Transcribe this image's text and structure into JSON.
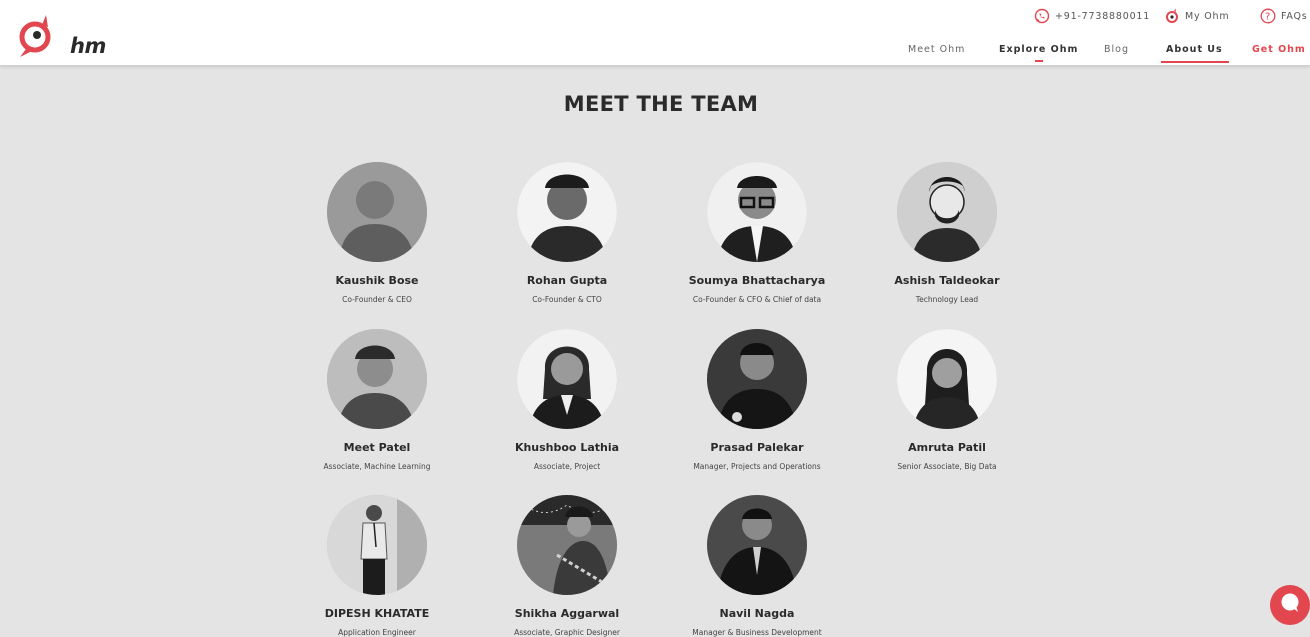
{
  "brand": {
    "logo_text": "hm",
    "accent": "#e2474f"
  },
  "top_links": [
    {
      "icon": "whatsapp-icon",
      "label": "+91-7738880011"
    },
    {
      "icon": "ohm-pin-icon",
      "label": "My Ohm"
    },
    {
      "icon": "question-icon",
      "label": "FAQs"
    }
  ],
  "nav": [
    {
      "label": "Meet Ohm"
    },
    {
      "label": "Explore Ohm"
    },
    {
      "label": "Blog"
    },
    {
      "label": "About Us",
      "active": true
    },
    {
      "label": "Get Ohm"
    }
  ],
  "section": {
    "title": "MEET THE TEAM"
  },
  "team": [
    {
      "name": "Kaushik Bose",
      "role": "Co-Founder & CEO"
    },
    {
      "name": "Rohan Gupta",
      "role": "Co-Founder & CTO"
    },
    {
      "name": "Soumya Bhattacharya",
      "role": "Co-Founder & CFO & Chief of data"
    },
    {
      "name": "Ashish Taldeokar",
      "role": "Technology Lead"
    },
    {
      "name": "Meet Patel",
      "role": "Associate, Machine Learning"
    },
    {
      "name": "Khushboo Lathia",
      "role": "Associate, Project"
    },
    {
      "name": "Prasad Palekar",
      "role": "Manager, Projects and Operations"
    },
    {
      "name": "Amruta Patil",
      "role": "Senior Associate, Big Data"
    },
    {
      "name": "DIPESH KHATATE",
      "role": "Application Engineer"
    },
    {
      "name": "Shikha Aggarwal",
      "role": "Associate, Graphic Designer"
    },
    {
      "name": "Navil Nagda",
      "role": "Manager & Business Development"
    }
  ],
  "chat": {
    "icon": "chat-bubble-icon"
  }
}
